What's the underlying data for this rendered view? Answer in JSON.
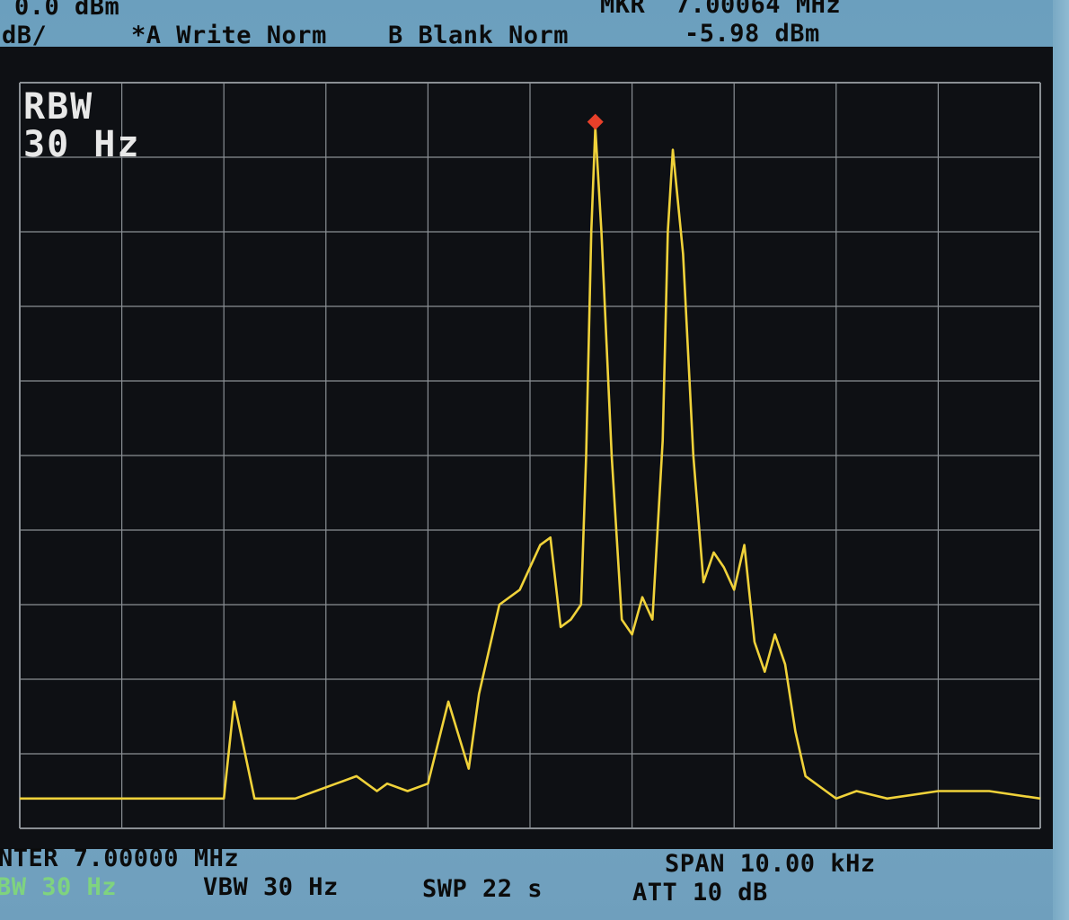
{
  "header": {
    "ref_level": "0.0 dBm",
    "scale": "dB/",
    "trace_a": "*A_Write Norm",
    "trace_b": "B_Blank Norm",
    "marker_freq": "MKR  7.00064 MHz",
    "marker_level": "-5.98 dBm"
  },
  "overlay": {
    "rbw_label": "RBW",
    "rbw_value": "30 Hz"
  },
  "footer": {
    "center": "NTER 7.00000 MHz",
    "span": "SPAN 10.00 kHz",
    "rbw": "BW 30 Hz",
    "vbw": "VBW 30 Hz",
    "sweep": "SWP 22 s",
    "att": "ATT 10 dB"
  },
  "colors": {
    "trace": "#f0d23a",
    "marker": "#e8402a",
    "grid": "#8a8f94",
    "background": "#0e1014",
    "footer_green": "#7fd37f"
  },
  "chart_data": {
    "type": "line",
    "title": "",
    "xlabel": "",
    "ylabel": "",
    "x_unit": "kHz",
    "y_unit": "dBm",
    "xlim": [
      6995.0,
      7005.0
    ],
    "ylim": [
      -100.0,
      0.0
    ],
    "grid": true,
    "grid_divisions": {
      "x": 10,
      "y": 10
    },
    "marker": {
      "x": 7000.64,
      "y": -5.98
    },
    "series": [
      {
        "x": [
          6995.0,
          6995.5,
          6996.0,
          6996.5,
          6997.0,
          6997.1,
          6997.3,
          6997.5,
          6997.7,
          6997.9,
          6998.1,
          6998.3,
          6998.5,
          6998.6,
          6998.8,
          6999.0,
          6999.2,
          6999.4,
          6999.5,
          6999.7,
          6999.9,
          7000.1,
          7000.2,
          7000.3,
          7000.4,
          7000.5,
          7000.55,
          7000.6,
          7000.64,
          7000.7,
          7000.8,
          7000.9,
          7001.0,
          7001.1,
          7001.2,
          7001.3,
          7001.35,
          7001.4,
          7001.5,
          7001.6,
          7001.7,
          7001.8,
          7001.9,
          7002.0,
          7002.1,
          7002.2,
          7002.3,
          7002.4,
          7002.5,
          7002.6,
          7002.7,
          7002.9,
          7003.0,
          7003.2,
          7003.5,
          7004.0,
          7004.5,
          7005.0
        ],
        "y": [
          -96,
          -96,
          -96,
          -96,
          -96,
          -83,
          -96,
          -96,
          -96,
          -95,
          -94,
          -93,
          -95,
          -94,
          -95,
          -94,
          -83,
          -92,
          -82,
          -70,
          -68,
          -62,
          -61,
          -73,
          -72,
          -70,
          -50,
          -20,
          -6,
          -20,
          -50,
          -72,
          -74,
          -69,
          -72,
          -48,
          -20,
          -9,
          -23,
          -50,
          -67,
          -63,
          -65,
          -68,
          -62,
          -75,
          -79,
          -74,
          -78,
          -87,
          -93,
          -95,
          -96,
          -95,
          -96,
          -95,
          -95,
          -96
        ]
      }
    ],
    "annotations": [
      "RBW",
      "30 Hz"
    ]
  }
}
